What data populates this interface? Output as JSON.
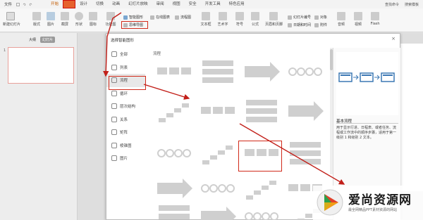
{
  "menubar": {
    "file": "文件",
    "tabs": [
      {
        "label": "开始",
        "active": true
      },
      {
        "label": "",
        "highlight": true
      },
      {
        "label": "设计"
      },
      {
        "label": "切换"
      },
      {
        "label": "动画"
      },
      {
        "label": "幻灯片放映"
      },
      {
        "label": "审阅"
      },
      {
        "label": "视图"
      },
      {
        "label": "安全"
      },
      {
        "label": "开发工具"
      },
      {
        "label": "特色应用"
      }
    ],
    "search": "查找命令",
    "search_template": "搜索模板"
  },
  "ribbon": {
    "new_slide": "新建幻灯片",
    "layout": "版式",
    "image": "图片",
    "screenshot": "截屏",
    "shape": "形状",
    "icon": "图标",
    "function_chart": "功能图",
    "smart_art": "智能图形",
    "online_chart": "在线图表",
    "mind_map": "思维导图",
    "process_chart": "流程图",
    "textbox": "文本框",
    "art_text": "艺术字",
    "symbol": "符号",
    "formula": "公式",
    "header_footer": "页眉和页脚",
    "slide_number": "幻灯片编号",
    "object": "对象",
    "datetime": "日期和时间",
    "attachment": "附件",
    "audio": "音频",
    "video": "视频",
    "flash": "Flash"
  },
  "left_panel": {
    "outline_tab": "大纲",
    "slides_tab": "幻灯片",
    "slide_number": "1"
  },
  "dialog": {
    "title": "选择智能图形",
    "close": "×",
    "categories": [
      {
        "label": "全部",
        "icon": "all-icon"
      },
      {
        "label": "列表",
        "icon": "list-icon"
      },
      {
        "label": "流程",
        "icon": "process-icon",
        "selected": true
      },
      {
        "label": "循环",
        "icon": "cycle-icon"
      },
      {
        "label": "层次结构",
        "icon": "hierarchy-icon"
      },
      {
        "label": "关系",
        "icon": "relationship-icon"
      },
      {
        "label": "矩阵",
        "icon": "matrix-icon"
      },
      {
        "label": "棱锥图",
        "icon": "pyramid-icon"
      },
      {
        "label": "图片",
        "icon": "picture-icon"
      }
    ],
    "section_header": "流程",
    "preview_title": "基本流程",
    "preview_desc": "用于显示行进、日程表、或者任务、流程或工作流中的顺序步骤，适用于第一级别 1 和级别 2 文本。"
  },
  "watermark": {
    "title": "爱尚资源网",
    "subtitle": "最全网精品PPT素材资源的网站"
  },
  "colors": {
    "highlight": "#e6612d",
    "callout_red": "#d12a1a",
    "arrow_red": "#c2201a",
    "template_gray": "#cfcfcf",
    "preview_blue": "#3c78b4"
  }
}
